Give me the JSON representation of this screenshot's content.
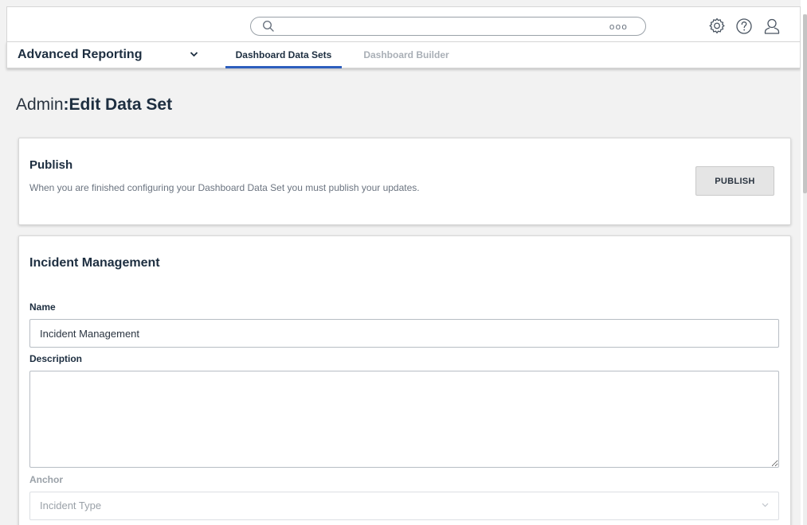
{
  "topbar": {
    "search_placeholder": "",
    "more_glyph": "ooo",
    "icons": [
      "magnifier-icon",
      "gear-icon",
      "help-icon",
      "user-icon"
    ]
  },
  "appbar": {
    "app_name": "Advanced Reporting",
    "chevron": "⌄",
    "tabs": [
      {
        "label": "Dashboard Data Sets",
        "active": true
      },
      {
        "label": "Dashboard Builder",
        "active": false
      }
    ]
  },
  "page": {
    "title_prefix": "Admin",
    "title_separator": ":",
    "title_main": "Edit Data Set"
  },
  "publish": {
    "heading": "Publish",
    "description": "When you are finished configuring your Dashboard Data Set you must publish your updates.",
    "button_label": "PUBLISH"
  },
  "dataset": {
    "heading": "Incident Management",
    "name_label": "Name",
    "name_value": "Incident Management",
    "description_label": "Description",
    "description_value": "",
    "anchor_label": "Anchor",
    "anchor_value": "Incident Type",
    "anchor_chevron": "⌄"
  },
  "colors": {
    "accent": "#2d5ebd",
    "heading": "#1d2e40",
    "muted": "#9aa1a8",
    "background": "#f2f2f2"
  }
}
